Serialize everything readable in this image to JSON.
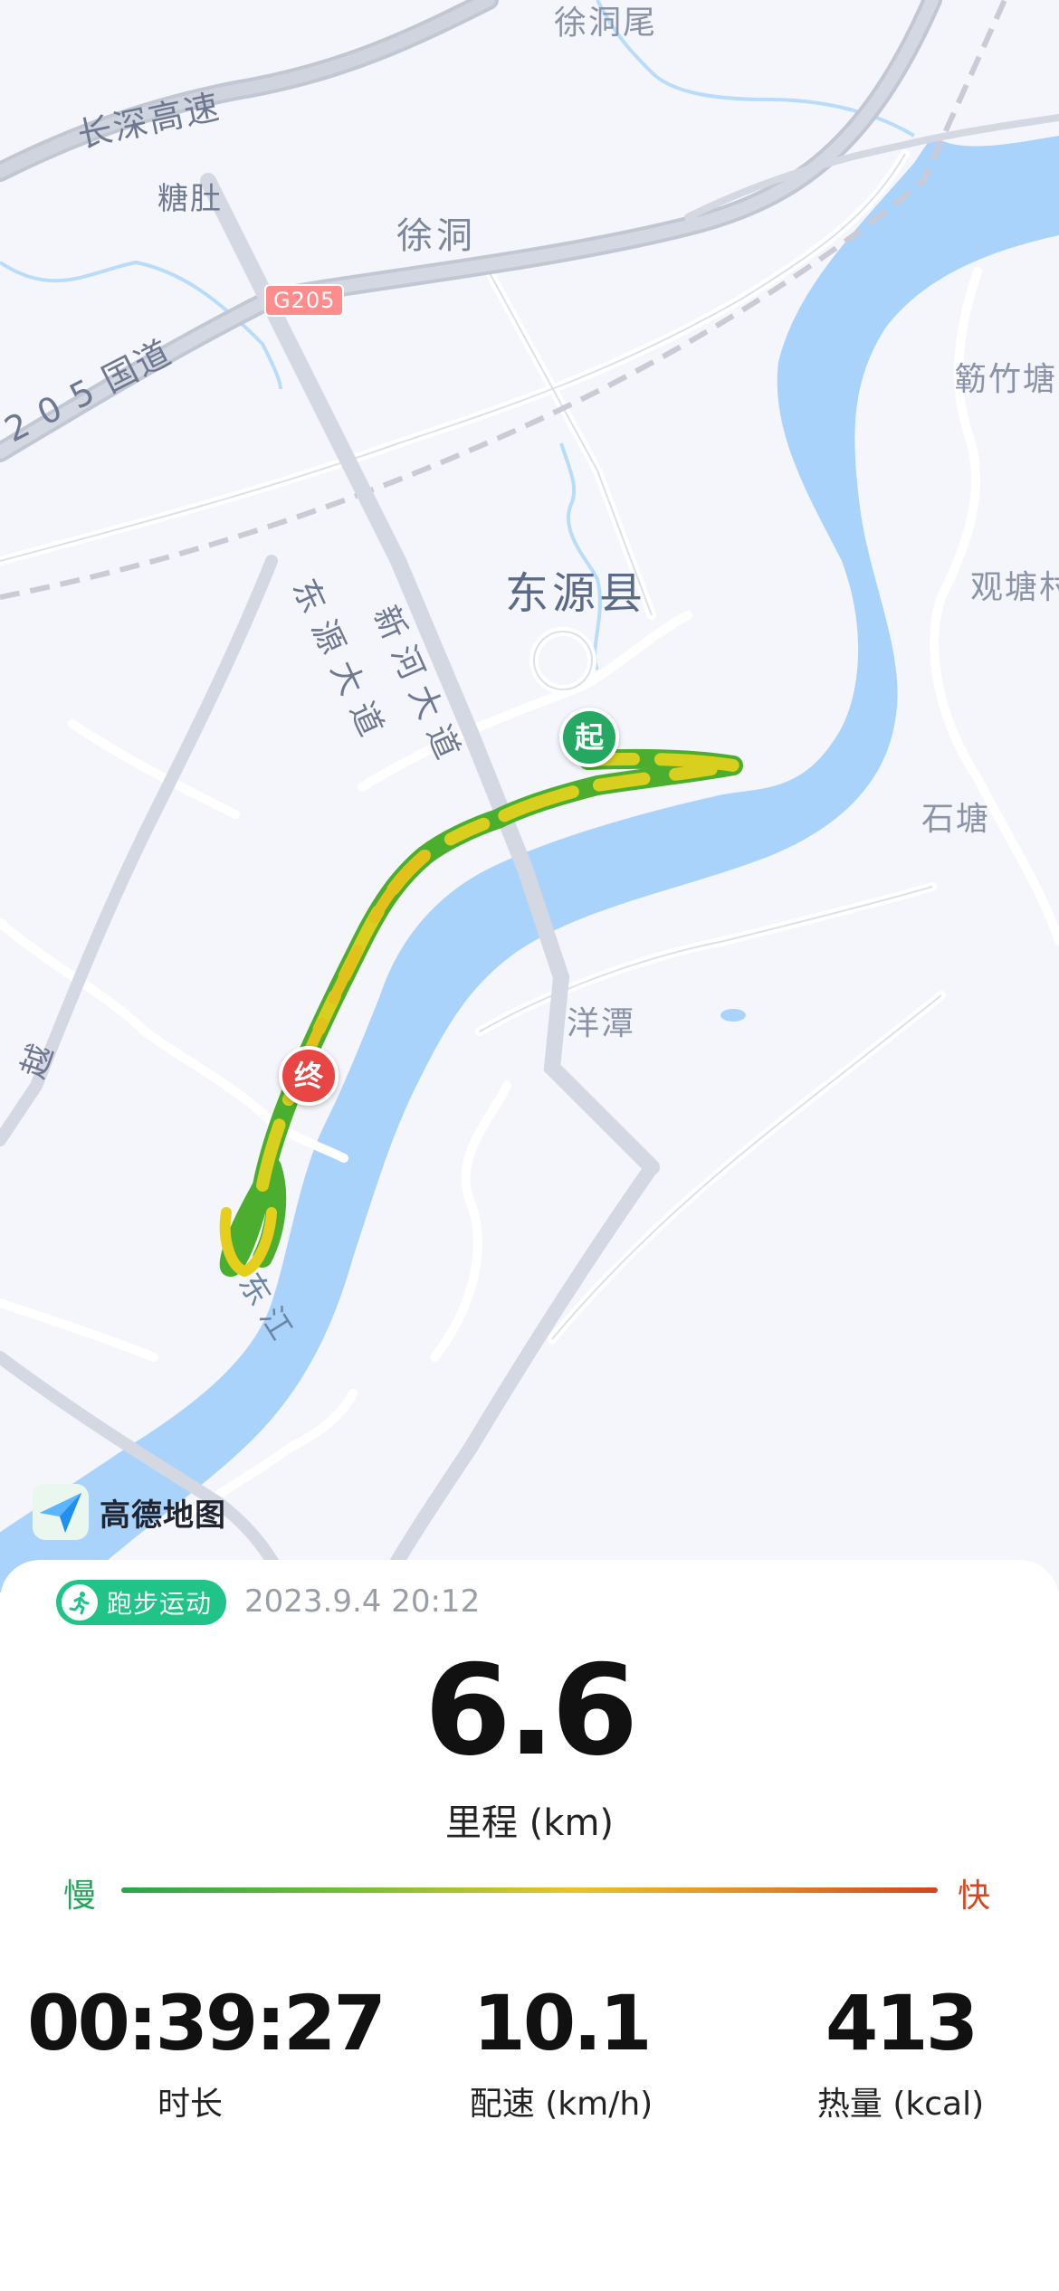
{
  "map": {
    "labels": {
      "xudongwei": "徐洞尾",
      "changshen": "长深高速",
      "tangdu": "糖肚",
      "xudong": "徐洞",
      "g205": "G205",
      "guodao205": "2 0 5 国道",
      "dongyuanxian": "东源县",
      "dongyuan_avenue": "东源大道",
      "xinhe_avenue": "新河大道",
      "yuezhutang": "簕竹塘",
      "guantang": "观塘村",
      "shitang": "石塘",
      "yangtan": "洋潭",
      "yue": "越",
      "dongjiang": "东江"
    },
    "markers": {
      "start": "起",
      "end": "终"
    },
    "brand": "高德地图"
  },
  "summary": {
    "activity_type": "跑步运动",
    "datetime": "2023.9.4 20:12",
    "distance_value": "6.6",
    "distance_label": "里程 (km)",
    "slow_label": "慢",
    "fast_label": "快",
    "duration_value": "00:39:27",
    "duration_label": "时长",
    "speed_value": "10.1",
    "speed_label": "配速 (km/h)",
    "calories_value": "413",
    "calories_label": "热量 (kcal)"
  },
  "colors": {
    "river": "#a9d3fb",
    "accent_green": "#20c489",
    "slow_color": "#27a35b",
    "fast_color": "#d8461f",
    "start_marker": "#24a862",
    "end_marker": "#e84545"
  }
}
